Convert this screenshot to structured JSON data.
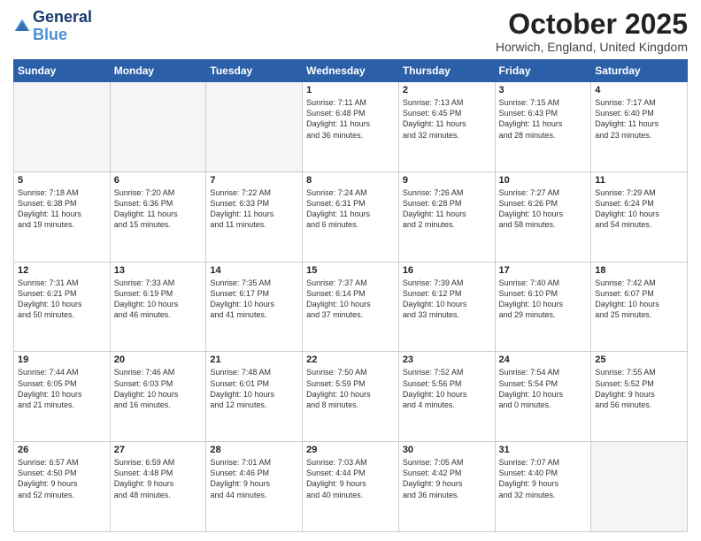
{
  "header": {
    "logo_line1": "General",
    "logo_line2": "Blue",
    "month": "October 2025",
    "location": "Horwich, England, United Kingdom"
  },
  "weekdays": [
    "Sunday",
    "Monday",
    "Tuesday",
    "Wednesday",
    "Thursday",
    "Friday",
    "Saturday"
  ],
  "rows": [
    [
      {
        "day": "",
        "text": ""
      },
      {
        "day": "",
        "text": ""
      },
      {
        "day": "",
        "text": ""
      },
      {
        "day": "1",
        "text": "Sunrise: 7:11 AM\nSunset: 6:48 PM\nDaylight: 11 hours\nand 36 minutes."
      },
      {
        "day": "2",
        "text": "Sunrise: 7:13 AM\nSunset: 6:45 PM\nDaylight: 11 hours\nand 32 minutes."
      },
      {
        "day": "3",
        "text": "Sunrise: 7:15 AM\nSunset: 6:43 PM\nDaylight: 11 hours\nand 28 minutes."
      },
      {
        "day": "4",
        "text": "Sunrise: 7:17 AM\nSunset: 6:40 PM\nDaylight: 11 hours\nand 23 minutes."
      }
    ],
    [
      {
        "day": "5",
        "text": "Sunrise: 7:18 AM\nSunset: 6:38 PM\nDaylight: 11 hours\nand 19 minutes."
      },
      {
        "day": "6",
        "text": "Sunrise: 7:20 AM\nSunset: 6:36 PM\nDaylight: 11 hours\nand 15 minutes."
      },
      {
        "day": "7",
        "text": "Sunrise: 7:22 AM\nSunset: 6:33 PM\nDaylight: 11 hours\nand 11 minutes."
      },
      {
        "day": "8",
        "text": "Sunrise: 7:24 AM\nSunset: 6:31 PM\nDaylight: 11 hours\nand 6 minutes."
      },
      {
        "day": "9",
        "text": "Sunrise: 7:26 AM\nSunset: 6:28 PM\nDaylight: 11 hours\nand 2 minutes."
      },
      {
        "day": "10",
        "text": "Sunrise: 7:27 AM\nSunset: 6:26 PM\nDaylight: 10 hours\nand 58 minutes."
      },
      {
        "day": "11",
        "text": "Sunrise: 7:29 AM\nSunset: 6:24 PM\nDaylight: 10 hours\nand 54 minutes."
      }
    ],
    [
      {
        "day": "12",
        "text": "Sunrise: 7:31 AM\nSunset: 6:21 PM\nDaylight: 10 hours\nand 50 minutes."
      },
      {
        "day": "13",
        "text": "Sunrise: 7:33 AM\nSunset: 6:19 PM\nDaylight: 10 hours\nand 46 minutes."
      },
      {
        "day": "14",
        "text": "Sunrise: 7:35 AM\nSunset: 6:17 PM\nDaylight: 10 hours\nand 41 minutes."
      },
      {
        "day": "15",
        "text": "Sunrise: 7:37 AM\nSunset: 6:14 PM\nDaylight: 10 hours\nand 37 minutes."
      },
      {
        "day": "16",
        "text": "Sunrise: 7:39 AM\nSunset: 6:12 PM\nDaylight: 10 hours\nand 33 minutes."
      },
      {
        "day": "17",
        "text": "Sunrise: 7:40 AM\nSunset: 6:10 PM\nDaylight: 10 hours\nand 29 minutes."
      },
      {
        "day": "18",
        "text": "Sunrise: 7:42 AM\nSunset: 6:07 PM\nDaylight: 10 hours\nand 25 minutes."
      }
    ],
    [
      {
        "day": "19",
        "text": "Sunrise: 7:44 AM\nSunset: 6:05 PM\nDaylight: 10 hours\nand 21 minutes."
      },
      {
        "day": "20",
        "text": "Sunrise: 7:46 AM\nSunset: 6:03 PM\nDaylight: 10 hours\nand 16 minutes."
      },
      {
        "day": "21",
        "text": "Sunrise: 7:48 AM\nSunset: 6:01 PM\nDaylight: 10 hours\nand 12 minutes."
      },
      {
        "day": "22",
        "text": "Sunrise: 7:50 AM\nSunset: 5:59 PM\nDaylight: 10 hours\nand 8 minutes."
      },
      {
        "day": "23",
        "text": "Sunrise: 7:52 AM\nSunset: 5:56 PM\nDaylight: 10 hours\nand 4 minutes."
      },
      {
        "day": "24",
        "text": "Sunrise: 7:54 AM\nSunset: 5:54 PM\nDaylight: 10 hours\nand 0 minutes."
      },
      {
        "day": "25",
        "text": "Sunrise: 7:55 AM\nSunset: 5:52 PM\nDaylight: 9 hours\nand 56 minutes."
      }
    ],
    [
      {
        "day": "26",
        "text": "Sunrise: 6:57 AM\nSunset: 4:50 PM\nDaylight: 9 hours\nand 52 minutes."
      },
      {
        "day": "27",
        "text": "Sunrise: 6:59 AM\nSunset: 4:48 PM\nDaylight: 9 hours\nand 48 minutes."
      },
      {
        "day": "28",
        "text": "Sunrise: 7:01 AM\nSunset: 4:46 PM\nDaylight: 9 hours\nand 44 minutes."
      },
      {
        "day": "29",
        "text": "Sunrise: 7:03 AM\nSunset: 4:44 PM\nDaylight: 9 hours\nand 40 minutes."
      },
      {
        "day": "30",
        "text": "Sunrise: 7:05 AM\nSunset: 4:42 PM\nDaylight: 9 hours\nand 36 minutes."
      },
      {
        "day": "31",
        "text": "Sunrise: 7:07 AM\nSunset: 4:40 PM\nDaylight: 9 hours\nand 32 minutes."
      },
      {
        "day": "",
        "text": ""
      }
    ]
  ]
}
